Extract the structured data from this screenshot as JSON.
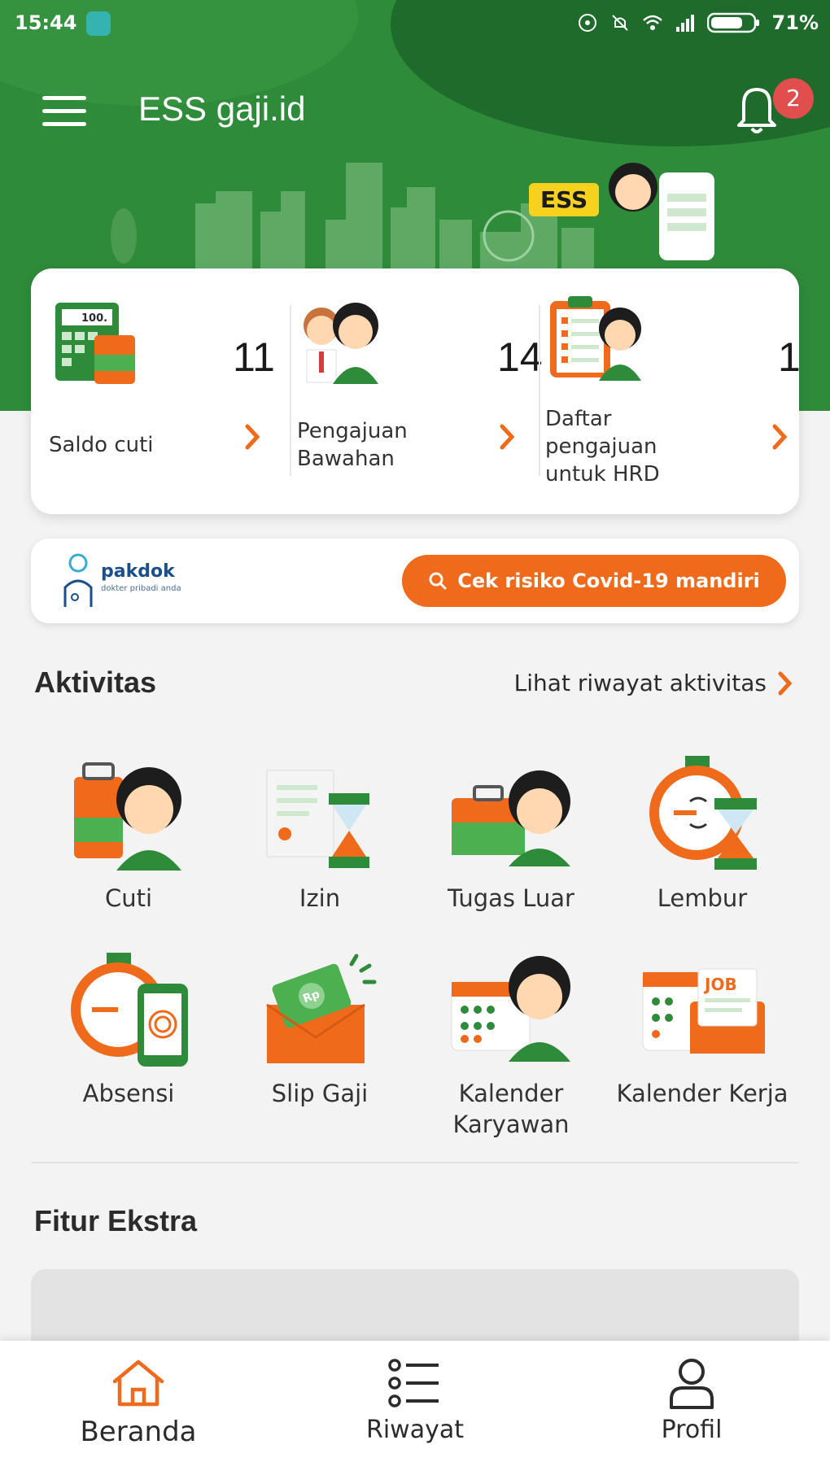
{
  "status_bar": {
    "time": "15:44",
    "battery": "71%"
  },
  "header": {
    "title": "ESS gaji.id",
    "notification_count": "2",
    "banner_tag": "ESS"
  },
  "summary": [
    {
      "label": "Saldo cuti",
      "count": "11"
    },
    {
      "label": "Pengajuan Bawahan",
      "count": "14"
    },
    {
      "label": "Daftar pengajuan untuk HRD",
      "count": "1"
    }
  ],
  "pakdok": {
    "brand": "pakdok",
    "tagline": "dokter pribadi anda",
    "button_label": "Cek risiko Covid-19 mandiri"
  },
  "aktivitas": {
    "title": "Aktivitas",
    "history_link": "Lihat riwayat aktivitas",
    "items": [
      {
        "label": "Cuti",
        "icon": "luggage-icon"
      },
      {
        "label": "Izin",
        "icon": "permit-hourglass-icon"
      },
      {
        "label": "Tugas Luar",
        "icon": "briefcase-icon"
      },
      {
        "label": "Lembur",
        "icon": "overtime-clock-icon"
      },
      {
        "label": "Absensi",
        "icon": "fingerprint-phone-icon"
      },
      {
        "label": "Slip Gaji",
        "icon": "payslip-envelope-icon"
      },
      {
        "label": "Kalender Karyawan",
        "icon": "employee-calendar-icon"
      },
      {
        "label": "Kalender Kerja",
        "icon": "job-calendar-icon"
      }
    ]
  },
  "fitur_ekstra": {
    "title": "Fitur Ekstra"
  },
  "bottom_nav": [
    {
      "label": "Beranda",
      "icon": "home-icon",
      "active": true
    },
    {
      "label": "Riwayat",
      "icon": "list-icon",
      "active": false
    },
    {
      "label": "Profil",
      "icon": "user-icon",
      "active": false
    }
  ],
  "colors": {
    "primary_green": "#2e8b3a",
    "accent_orange": "#ef6a1a",
    "badge_red": "#e04e4e"
  }
}
